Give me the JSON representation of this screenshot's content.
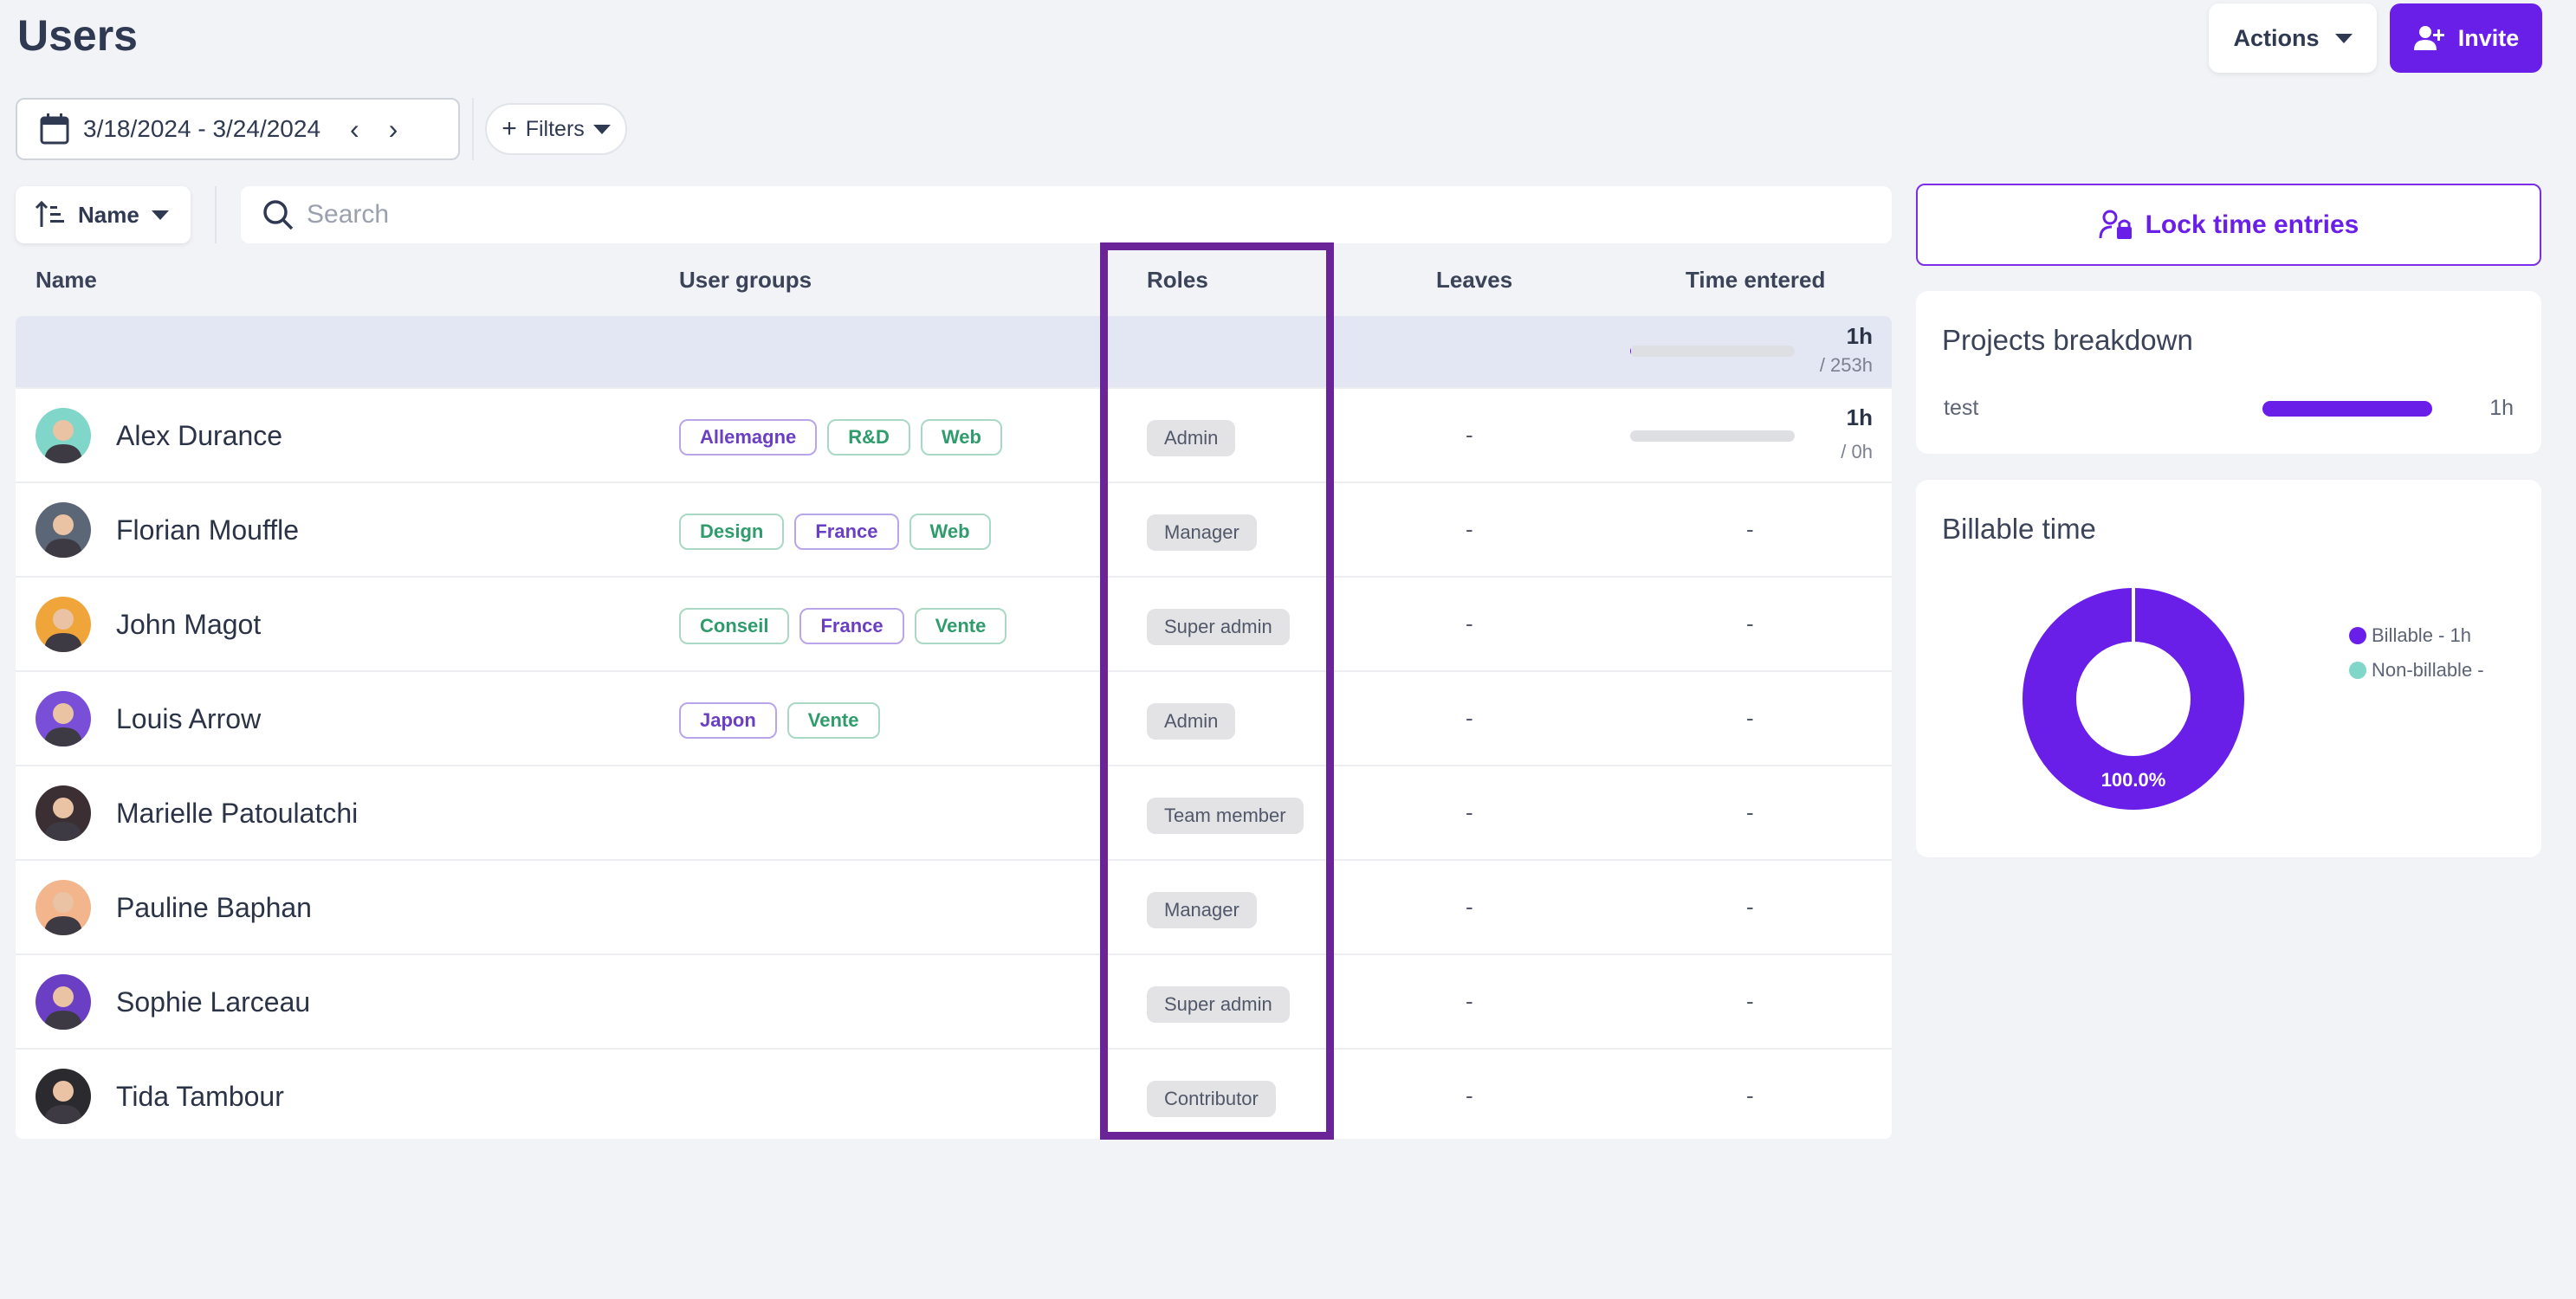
{
  "header": {
    "title": "Users",
    "actions_label": "Actions",
    "invite_label": "Invite"
  },
  "toolbar": {
    "date_range": "3/18/2024 - 3/24/2024",
    "filters_label": "Filters",
    "sort_label": "Name",
    "search_placeholder": "Search"
  },
  "table": {
    "columns": {
      "name": "Name",
      "groups": "User groups",
      "roles": "Roles",
      "leaves": "Leaves",
      "time": "Time entered"
    },
    "total": {
      "time": "1h",
      "capacity": "/ 253h",
      "progress": 0.004
    },
    "rows": [
      {
        "name": "Alex Durance",
        "avatar_color": "#7fd6c9",
        "groups": [
          {
            "label": "Allemagne",
            "color": "purple"
          },
          {
            "label": "R&D",
            "color": "green"
          },
          {
            "label": "Web",
            "color": "green"
          }
        ],
        "role": "Admin",
        "leaves": "-",
        "time": "1h",
        "capacity": "/ 0h",
        "has_progress": true
      },
      {
        "name": "Florian Mouffle",
        "avatar_color": "#5b6677",
        "groups": [
          {
            "label": "Design",
            "color": "green"
          },
          {
            "label": "France",
            "color": "purple"
          },
          {
            "label": "Web",
            "color": "green"
          }
        ],
        "role": "Manager",
        "leaves": "-",
        "time": "-"
      },
      {
        "name": "John Magot",
        "avatar_color": "#f0a53a",
        "groups": [
          {
            "label": "Conseil",
            "color": "green"
          },
          {
            "label": "France",
            "color": "purple"
          },
          {
            "label": "Vente",
            "color": "green"
          }
        ],
        "role": "Super admin",
        "leaves": "-",
        "time": "-"
      },
      {
        "name": "Louis Arrow",
        "avatar_color": "#7a4fd8",
        "groups": [
          {
            "label": "Japon",
            "color": "purple"
          },
          {
            "label": "Vente",
            "color": "green"
          }
        ],
        "role": "Admin",
        "leaves": "-",
        "time": "-"
      },
      {
        "name": "Marielle Patoulatchi",
        "avatar_color": "#3b2f33",
        "groups": [],
        "role": "Team member",
        "leaves": "-",
        "time": "-"
      },
      {
        "name": "Pauline Baphan",
        "avatar_color": "#f3b58c",
        "groups": [],
        "role": "Manager",
        "leaves": "-",
        "time": "-"
      },
      {
        "name": "Sophie Larceau",
        "avatar_color": "#6a3fc4",
        "groups": [],
        "role": "Super admin",
        "leaves": "-",
        "time": "-"
      },
      {
        "name": "Tida Tambour",
        "avatar_color": "#2a2a2f",
        "groups": [],
        "role": "Contributor",
        "leaves": "-",
        "time": "-"
      }
    ]
  },
  "sidebar": {
    "lock_label": "Lock time entries",
    "projects": {
      "title": "Projects breakdown",
      "items": [
        {
          "name": "test",
          "value": "1h"
        }
      ]
    },
    "billable": {
      "title": "Billable time",
      "center_label": "100.0%",
      "legend": [
        {
          "label": "Billable - 1h",
          "color": "#6a1fe8"
        },
        {
          "label": "Non-billable -",
          "color": "#7fd6c9"
        }
      ]
    }
  },
  "chart_data": {
    "type": "pie",
    "categories": [
      "Billable",
      "Non-billable"
    ],
    "values": [
      100,
      0
    ],
    "title": "Billable time"
  },
  "colors": {
    "accent": "#6a1fe8",
    "highlight": "#6b2398"
  }
}
